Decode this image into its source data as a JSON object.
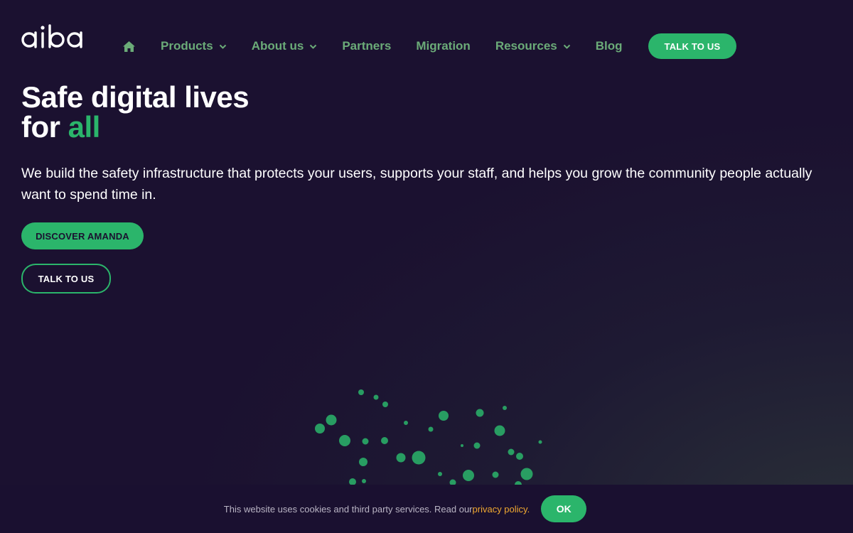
{
  "brand": {
    "logo_text": "aiba",
    "accent_color": "#2bb56b",
    "nav_text_color": "#6bab78",
    "background_color": "#1b1130",
    "link_color": "#f0a830"
  },
  "nav": {
    "home_icon": "home-icon",
    "items": [
      {
        "label": "Products",
        "has_dropdown": true
      },
      {
        "label": "About us",
        "has_dropdown": true
      },
      {
        "label": "Partners",
        "has_dropdown": false
      },
      {
        "label": "Migration",
        "has_dropdown": false
      },
      {
        "label": "Resources",
        "has_dropdown": true
      },
      {
        "label": "Blog",
        "has_dropdown": false
      }
    ],
    "cta_label": "TALK TO US"
  },
  "hero": {
    "title_line1": "Safe digital lives",
    "title_line2_prefix": "for ",
    "title_line2_accent": "all",
    "subtitle": "We build the safety infrastructure that protects your users, supports your staff, and helps you grow the community people actually want to spend time in.",
    "primary_button": "DISCOVER AMANDA",
    "secondary_button": "TALK TO US"
  },
  "cookie": {
    "text": "This website uses cookies and third party services. Read our",
    "link": "privacy policy.",
    "button": "OK"
  }
}
